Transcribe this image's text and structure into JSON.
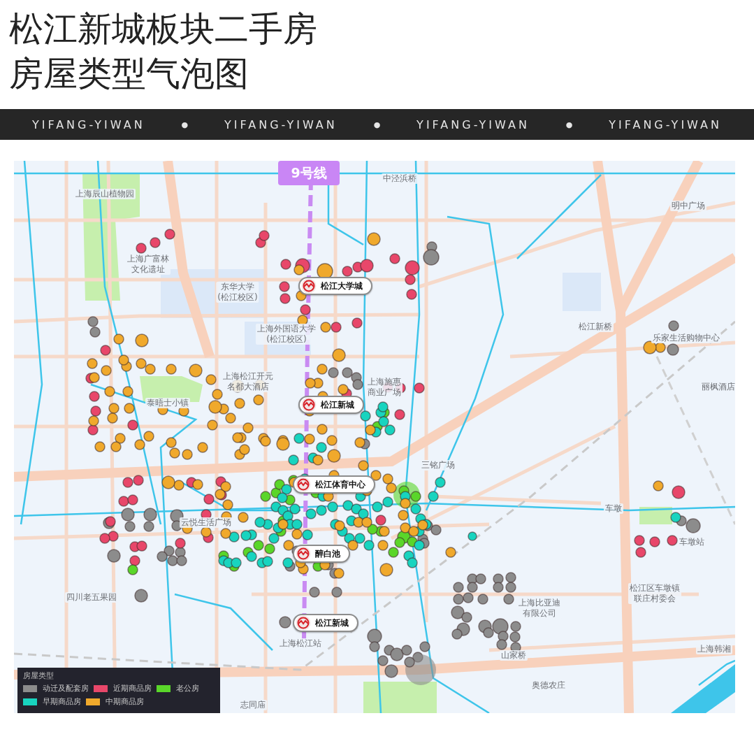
{
  "header": {
    "title_lines": [
      "松江新城板块二手房",
      "房屋类型气泡图"
    ]
  },
  "banner": {
    "items": [
      {
        "kind": "text",
        "text": "YIFANG-YIWAN"
      },
      {
        "kind": "dot",
        "text": "●"
      },
      {
        "kind": "text",
        "text": "YIFANG-YIWAN"
      },
      {
        "kind": "dot",
        "text": "●"
      },
      {
        "kind": "text",
        "text": "YIFANG-YIWAN"
      },
      {
        "kind": "dot",
        "text": "●"
      },
      {
        "kind": "text",
        "text": "YIFANG-YIWAN"
      }
    ]
  },
  "map": {
    "line_badge": "9号线",
    "stations": [
      "松江大学城",
      "松江新城",
      "松江体育中心",
      "醉白池",
      "松江新城"
    ],
    "places": [
      {
        "lines": [
          "中泾浜桥"
        ]
      },
      {
        "lines": [
          "上海辰山植物园"
        ]
      },
      {
        "lines": [
          "明中广场"
        ]
      },
      {
        "lines": [
          "上海广富林",
          "文化遗址"
        ]
      },
      {
        "lines": [
          "东华大学",
          "(松江校区)"
        ]
      },
      {
        "lines": [
          "松江新桥"
        ]
      },
      {
        "lines": [
          "上海外国语大学",
          "(松江校区)"
        ]
      },
      {
        "lines": [
          "乐家生活购物中心"
        ]
      },
      {
        "lines": [
          "上海松江开元",
          "名都大酒店"
        ]
      },
      {
        "lines": [
          "上海施惠",
          "商业广场"
        ]
      },
      {
        "lines": [
          "丽枫酒店"
        ]
      },
      {
        "lines": [
          "泰晤士小镇"
        ]
      },
      {
        "lines": [
          "三铭广场"
        ]
      },
      {
        "lines": [
          "车墩"
        ]
      },
      {
        "lines": [
          "云悦生活广场"
        ]
      },
      {
        "lines": [
          "车墩站"
        ]
      },
      {
        "lines": [
          "四川老五果园"
        ]
      },
      {
        "lines": [
          "上海比亚迪",
          "有限公司"
        ]
      },
      {
        "lines": [
          "松江区车墩镇",
          "联庄村委会"
        ]
      },
      {
        "lines": [
          "上海松江站"
        ]
      },
      {
        "lines": [
          "上海韩湘"
        ]
      },
      {
        "lines": [
          "山家桥"
        ]
      },
      {
        "lines": [
          "奥德农庄"
        ]
      },
      {
        "lines": [
          "志同庙"
        ]
      }
    ],
    "legend": {
      "title": "房屋类型",
      "items": [
        {
          "label": "动迁及配套房",
          "color": "#8c8c8c"
        },
        {
          "label": "近期商品房",
          "color": "#e8476a"
        },
        {
          "label": "老公房",
          "color": "#5ad62a"
        },
        {
          "label": "早期商品房",
          "color": "#18d4bf"
        },
        {
          "label": "中期商品房",
          "color": "#f0a92c"
        }
      ]
    }
  }
}
